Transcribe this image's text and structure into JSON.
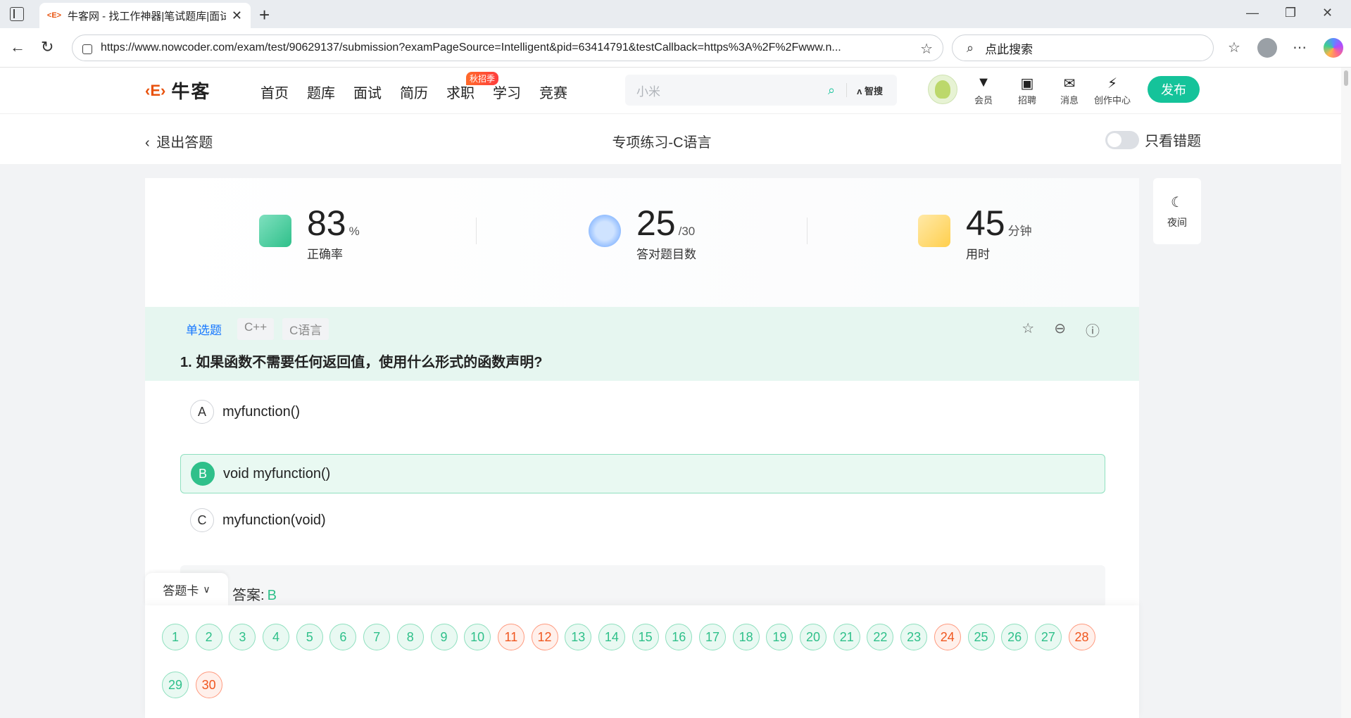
{
  "browser": {
    "tab_title": "牛客网 - 找工作神器|笔试题库|面试",
    "tab_favicon": "<E>",
    "url": "https://www.nowcoder.com/exam/test/90629137/submission?examPageSource=Intelligent&pid=63414791&testCallback=https%3A%2F%2Fwww.n...",
    "search_placeholder": "点此搜索"
  },
  "site": {
    "logo_text": "牛客",
    "nav": [
      "首页",
      "题库",
      "面试",
      "简历",
      "求职",
      "学习",
      "竞赛"
    ],
    "hot_badge": "秋招季",
    "search_value": "小米",
    "ai_search": "智搜",
    "header_icons": [
      {
        "label": "会员",
        "icon": "vip-icon"
      },
      {
        "label": "招聘",
        "icon": "recruit-icon"
      },
      {
        "label": "消息",
        "icon": "mail-icon"
      },
      {
        "label": "创作中心",
        "icon": "bulb-icon"
      }
    ],
    "publish": "发布"
  },
  "exam": {
    "back": "退出答题",
    "title": "专项练习-C语言",
    "wrong_only": "只看错题",
    "night": "夜间"
  },
  "stats": {
    "accuracy": {
      "value": "83",
      "unit": "%",
      "label": "正确率"
    },
    "correct": {
      "value": "25",
      "unit": "/30",
      "label": "答对题目数"
    },
    "time": {
      "value": "45",
      "unit": "分钟",
      "label": "用时"
    }
  },
  "question": {
    "tags": [
      "单选题",
      "C++",
      "C语言"
    ],
    "title": "1. 如果函数不需要任何返回值，使用什么形式的函数声明?",
    "options": [
      {
        "letter": "A",
        "text": "myfunction()",
        "selected": false
      },
      {
        "letter": "B",
        "text": "void myfunction()",
        "selected": true
      },
      {
        "letter": "C",
        "text": "myfunction(void)",
        "selected": false
      }
    ],
    "answer_label": "答案:",
    "answer_value": "B"
  },
  "answer_card": {
    "label": "答题卡",
    "numbers": [
      "1",
      "2",
      "3",
      "4",
      "5",
      "6",
      "7",
      "8",
      "9",
      "10",
      "11",
      "12",
      "13",
      "14",
      "15",
      "16",
      "17",
      "18",
      "19",
      "20",
      "21",
      "22",
      "23",
      "24",
      "25",
      "26",
      "27",
      "28",
      "29",
      "30"
    ],
    "wrong": [
      "11",
      "12",
      "24",
      "28",
      "30"
    ]
  },
  "colors": {
    "brand_green": "#15c39a",
    "correct": "#2fc08a",
    "wrong": "#f0561f",
    "brand_orange": "#e8520d"
  }
}
